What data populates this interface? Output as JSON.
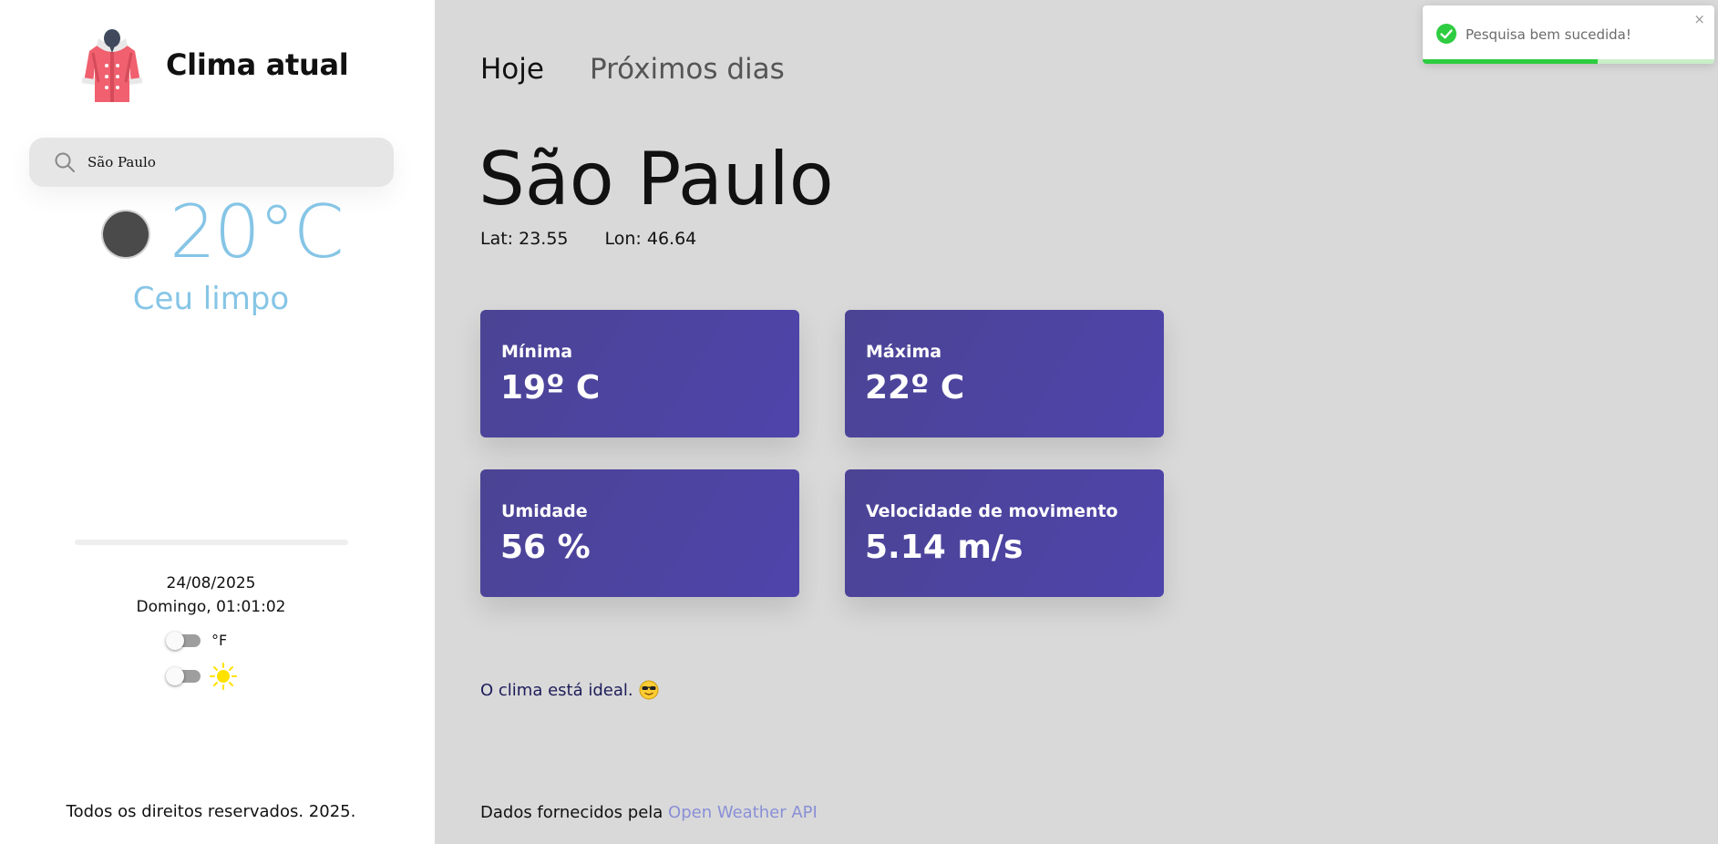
{
  "brand": {
    "title": "Clima atual"
  },
  "search": {
    "value": "São Paulo",
    "icon": "search-icon"
  },
  "current": {
    "temperature": "20°C",
    "description": "Ceu limpo",
    "icon": "moon-icon"
  },
  "datetime": {
    "date": "24/08/2025",
    "weekday_time": "Domingo, 01:01:02"
  },
  "toggles": {
    "unit_label": "°F",
    "theme_icon": "sun-icon"
  },
  "sidebar_footer": "Todos os direitos reservados. 2025.",
  "tabs": [
    {
      "label": "Hoje",
      "active": true
    },
    {
      "label": "Próximos dias",
      "active": false
    }
  ],
  "location": {
    "city": "São Paulo",
    "lat": "Lat: 23.55",
    "lon": "Lon: 46.64"
  },
  "cards": {
    "min": {
      "label": "Mínima",
      "value": "19º C"
    },
    "max": {
      "label": "Máxima",
      "value": "22º C"
    },
    "humidity": {
      "label": "Umidade",
      "value": "56 %"
    },
    "wind": {
      "label": "Velocidade de movimento",
      "value": "5.14 m/s"
    }
  },
  "message": {
    "text": "O clima está ideal.",
    "icon": "sunglasses-emoji-icon"
  },
  "footer": {
    "prefix": "Dados fornecidos pela",
    "link_text": "Open Weather API"
  },
  "toast": {
    "text": "Pesquisa bem sucedida!",
    "close": "×",
    "progress": 0.6
  },
  "colors": {
    "accent_text": "#86c5e6",
    "card_bg": "#4e44ab",
    "toast_success": "#2ecc40",
    "link": "#8a8fd6"
  }
}
